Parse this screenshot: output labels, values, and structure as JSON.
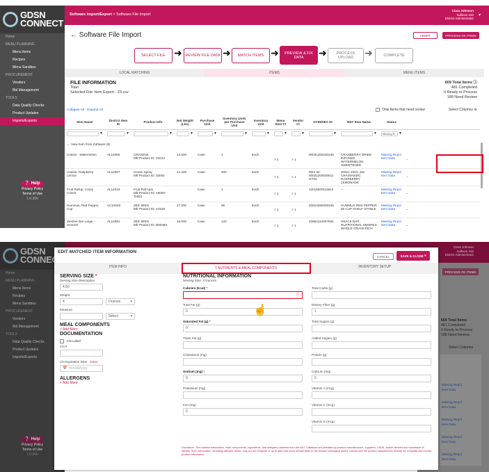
{
  "logo": {
    "line1": "GDSN",
    "line2": "CONNECT"
  },
  "nav": [
    {
      "t": "h",
      "label": "Home"
    },
    {
      "t": "h",
      "label": "MENU PLANNING"
    },
    {
      "t": "i",
      "label": "Menu Items"
    },
    {
      "t": "i",
      "label": "Recipes"
    },
    {
      "t": "i",
      "label": "Menu Sandbox"
    },
    {
      "t": "h",
      "label": "PROCUREMENT"
    },
    {
      "t": "i",
      "label": "Vendors"
    },
    {
      "t": "i",
      "label": "Bid Management"
    },
    {
      "t": "h",
      "label": "TOOLS"
    },
    {
      "t": "i",
      "label": "Data Quality Checks"
    },
    {
      "t": "i",
      "label": "Product Updates"
    },
    {
      "t": "i",
      "label": "Imports/Exports",
      "active": true
    }
  ],
  "help": {
    "label": "Help",
    "privacy": "Privacy Policy",
    "terms": "Terms of Use",
    "version": "1.0.309"
  },
  "header": {
    "breadcrumb_bold": "Software Import/Export",
    "breadcrumb_rest": " > Software File Import",
    "user": "Ciara Johnson",
    "district": "Sullivan ISD",
    "role": "District Administrator"
  },
  "page": {
    "title": "Software File Import",
    "abort": "ABORT",
    "process": "PROCESS OK ITEMS"
  },
  "steps": [
    "SELECT FILE",
    "REVIEW FILE DATA",
    "MATCH ITEMS",
    "PREVIEW & FIX DATA",
    "PROCESS UPLOAD",
    "COMPLETE"
  ],
  "tabs": [
    "LOCAL MATCHING",
    "ITEMS",
    "MENU ITEMS"
  ],
  "file": {
    "heading": "FILE INFORMATION",
    "name": "Titan",
    "selected": "Selected File: Item Export - 23.csv",
    "total": "669 Total Items",
    "completed": "481 Completed",
    "ready": "0 Ready to Process",
    "review": "188 Need Review"
  },
  "table_controls": {
    "collapse": "Collapse All",
    "expand": "Expand All",
    "need_review": "Only Items that need review",
    "select_cols": "Select Columns"
  },
  "columns": [
    "Item Name",
    "District Item ID",
    "Product Info",
    "Net Weight (Lbs)",
    "Purchase Unit",
    "Inventory Units per Purchase Unit",
    "Inventory Unit",
    "Menu Item Ct",
    "Vendor Ct",
    "GTIN/DEX ID",
    "NDT Item Name",
    "Status"
  ],
  "status_filter": "Missing R",
  "group": "New Item from Software (5)",
  "rows": [
    {
      "name": "Craisin - Watermelon",
      "id": "AL14066",
      "p1": "CRAISINS",
      "p2": "Mfr Product ID: 22044",
      "wt": "14.000",
      "pu": "Case",
      "ipu": "1",
      "iu": "Each",
      "mi": "> 1",
      "vc": "> 1",
      "gtin": "00031200220448",
      "ndt": "CRANBERRY DRIED INFUSED WATERMELON SWEETENED",
      "s1": "Missing Req'd",
      "s2": "Item Data"
    },
    {
      "name": "Craisin- Raspberry Lemon",
      "id": "AL14067",
      "p1": "Ocean Spray",
      "p2": "Mfr Product ID: 02061",
      "wt": "14.400",
      "pu": "Case",
      "ipu": "200",
      "iu": "Each",
      "mi": "> 1",
      "vc": "> 1",
      "gtin": "DEX ID: 00031200020611 GTIN:",
      "ndt": "20621 200/1.16z CRAISINS(R) RASPBERRY LEMONADE",
      "s1": "Missing Req'd",
      "s2": "Item Data"
    },
    {
      "name": "Fruit Rollup, Crazy Colors",
      "id": "AL14019",
      "p1": "Fruit Roll-Ups",
      "p2": "Mfr Product ID: 16000-11561",
      "wt": "",
      "pu": "Case",
      "ipu": "1",
      "iu": "Each",
      "mi": "> 1",
      "vc": "> 1",
      "gtin": "10016000115610",
      "ndt": "--",
      "s1": "Missing Req'd",
      "s2": "Item Data"
    },
    {
      "name": "Hummus, Red Pepper, Cup",
      "id": "VC10040",
      "p1": "ZEE ZEES",
      "p2": "Mfr Product ID: A0150",
      "wt": "27.000",
      "pu": "Case",
      "ipu": "96",
      "iu": "Each",
      "mi": "> 1",
      "vc": "> 1",
      "gtin": "20810380000345",
      "ndt": "HUMMUS RED PEPPER 06 CUP SHELF STABLE",
      "s1": "Missing Req'd",
      "s2": "Item Data"
    },
    {
      "name": "ZeeZee Bar Large - SmoreZ",
      "id": "AL14081",
      "p1": "ZEE ZEES",
      "p2": "Mfr Product ID: B60480",
      "wt": "16.000",
      "pu": "Case",
      "ipu": "120",
      "iu": "Each",
      "mi": "> 1",
      "vc": "> 1",
      "gtin": "20854114007594",
      "ndt": "SNACK BAR, NUTRITIONAL SMORES WHOLE-GRAIN-RICH",
      "s1": "Missing Req'd",
      "s2": "Item Data"
    }
  ],
  "modal": {
    "title": "EDIT MATCHED ITEM INFORMATION",
    "cancel": "CANCEL",
    "save": "SAVE & CLOSE",
    "tabs": [
      "ITEM INFO",
      "NUTRIENTS & MEAL COMPONENTS",
      "INVENTORY SETUP"
    ],
    "serving_size": "SERVING SIZE",
    "ss_desc": "Serving Size Description",
    "ss_value": "4.50",
    "weight": "Weight",
    "weight_value": "4",
    "weight_unit": "Ounces",
    "measure": "Measure",
    "measure_unit": "Select",
    "meal": "MEAL COMPONENTS",
    "add_more": "+ Add More",
    "doc": "DOCUMENTATION",
    "cn_label": "CN Label",
    "cn_num": "CN #",
    "cn_exp": "CN Expiration Date",
    "clear": "Clear",
    "date_ph": "mm/dd/yyyy",
    "allergens": "ALLERGENS",
    "add_more2": "+ Add More",
    "nutr": "NUTRITIONAL INFORMATION",
    "nutr_ss": "Serving Size: 4 Ounces",
    "left": [
      {
        "l": "Calories (Kcal)",
        "v": "",
        "bold": true,
        "req": true,
        "err": true
      },
      {
        "l": "Total Fat (g)",
        "v": "0"
      },
      {
        "l": "Saturated Fat (g)",
        "v": "0",
        "bold": true,
        "req": true
      },
      {
        "l": "Trans Fat (g)",
        "v": ""
      },
      {
        "l": "Cholesterol (mg)",
        "v": ""
      },
      {
        "l": "Sodium (mg)",
        "v": "0",
        "bold": true,
        "req": true
      },
      {
        "l": "Potassium (mg)",
        "v": ""
      },
      {
        "l": "Iron (mg)",
        "v": "0"
      }
    ],
    "right": [
      {
        "l": "Total Carbs (g)",
        "v": ""
      },
      {
        "l": "Dietary Fiber (g)",
        "v": "1"
      },
      {
        "l": "Total Sugars (g)",
        "v": ""
      },
      {
        "l": "Added Sugars (g)",
        "v": ""
      },
      {
        "l": "Protein (g)",
        "v": ""
      },
      {
        "l": "Calcium (mg)",
        "v": "5"
      },
      {
        "l": "Vitamin A (mcg)",
        "v": ""
      },
      {
        "l": "Vitamin C (mcg)",
        "v": ""
      },
      {
        "l": "Vitamin D (mcg)",
        "v": ""
      }
    ],
    "disclaimer": "Disclaimer: The nutrition information, meal components, ingredients, and allergens obtained from the NDT Database are provided by product manufacturers, suppliers, USDA, and/or derived from standards of identity. Such information, including allergen claims, may not be complete or up to date and users should defer to the product packaging and/or consult with the product manufacturer directly for complete and current product information."
  },
  "colors": {
    "accent": "#c2185b",
    "sidebar": "#4d4d4d",
    "link": "#1e5bd8",
    "highlight": "#e0001b"
  }
}
